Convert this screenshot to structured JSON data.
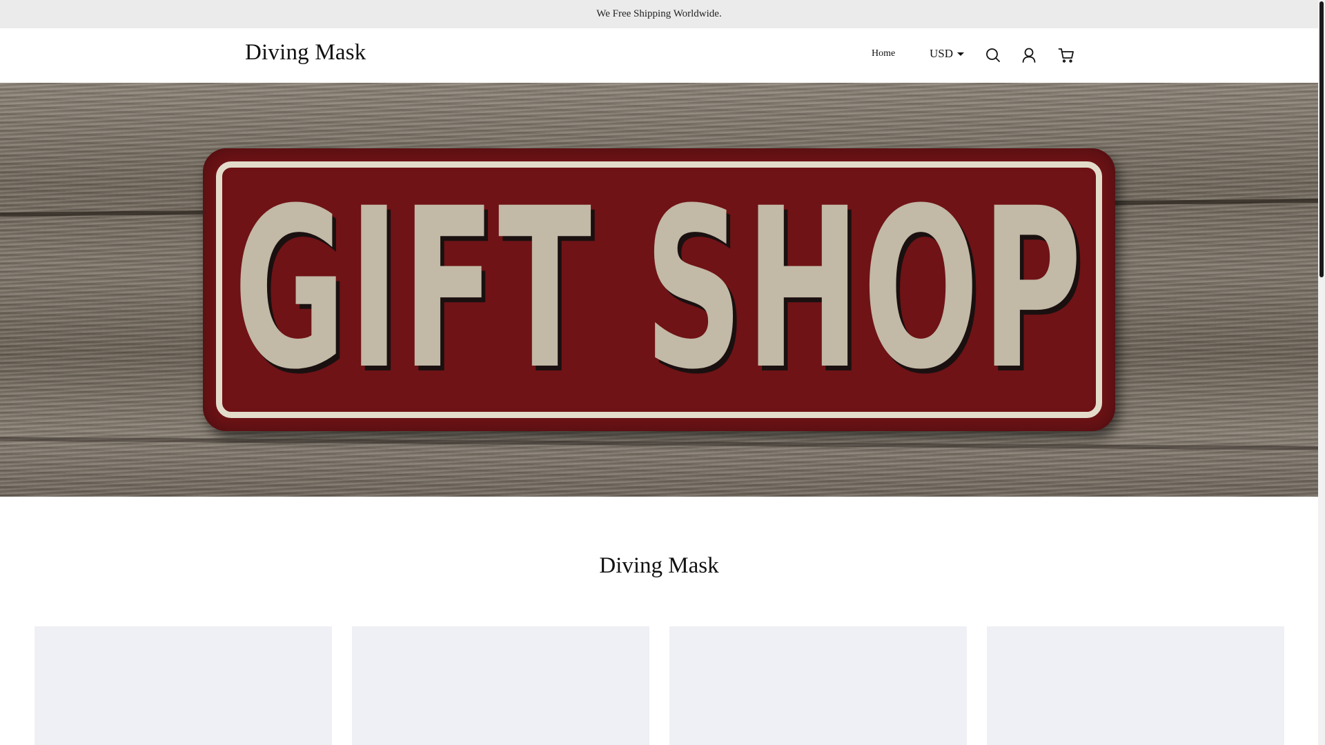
{
  "announcement": {
    "text": "We Free Shipping Worldwide."
  },
  "header": {
    "logo": "Diving Mask",
    "nav": [
      {
        "label": "Home"
      }
    ],
    "currency": {
      "selected": "USD"
    },
    "icons": {
      "search": "search-icon",
      "account": "user-icon",
      "cart": "cart-icon"
    }
  },
  "hero": {
    "sign_text": "GIFT SHOP",
    "colors": {
      "sign_red": "#6f1316",
      "sign_letters": "#c2b9a6",
      "wood": "#7d7468"
    }
  },
  "collection": {
    "title": "Diving Mask",
    "products": [
      {
        "placeholder_color": "#eff0f5"
      },
      {
        "placeholder_color": "#eff0f5"
      },
      {
        "placeholder_color": "#eff0f5"
      },
      {
        "placeholder_color": "#eff0f5"
      }
    ]
  }
}
